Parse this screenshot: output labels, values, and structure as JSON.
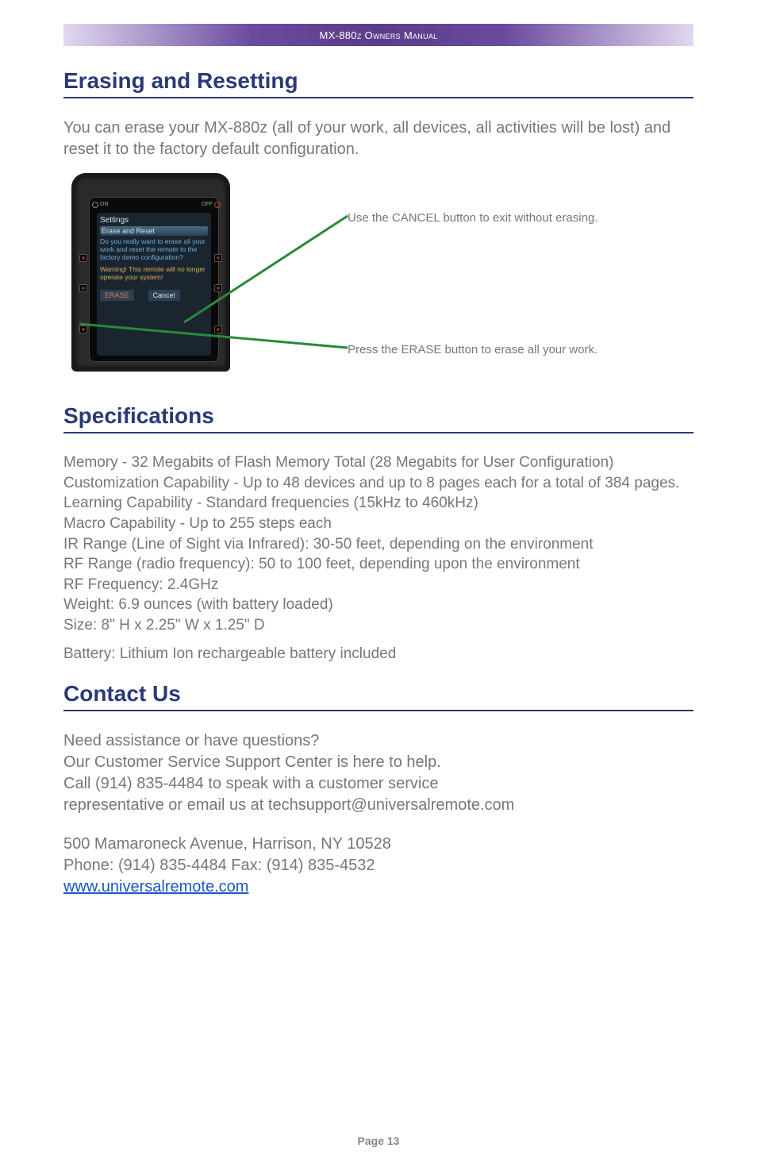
{
  "header": {
    "title": "MX-880z Owners Manual"
  },
  "section1": {
    "heading": "Erasing and Resetting",
    "intro": "You can erase your MX-880z (all of your work, all devices, all activities will be lost) and reset it to the factory default configuration.",
    "callout_cancel": "Use the CANCEL button to exit without erasing.",
    "callout_erase": "Press the ERASE button to erase all your work.",
    "screen": {
      "title": "Settings",
      "subtitle": "Erase and Reset",
      "msg": "Do you really want to erase all your work and reset the remote to the factory demo configuration?",
      "warn": "Warning! This remote will no longer operate your system!",
      "erase": "ERASE",
      "cancel": "Cancel",
      "on": "ON",
      "off": "OFF"
    }
  },
  "section2": {
    "heading": "Specifications",
    "lines": {
      "memory": "Memory - 32 Megabits of Flash Memory Total (28 Megabits for User Configuration)",
      "customization": "Customization Capability - Up to 48 devices and up to 8 pages each for a total of 384 pages.",
      "learning": "Learning Capability - Standard frequencies (15kHz to 460kHz)",
      "macro": "Macro Capability - Up to 255 steps each",
      "ir_range": "IR Range (Line of Sight via Infrared): 30-50 feet, depending on the environment",
      "rf_range": "RF Range (radio frequency): 50 to 100 feet, depending upon the environment",
      "rf_freq": "RF Frequency: 2.4GHz",
      "weight": "Weight: 6.9 ounces (with battery loaded)",
      "size": "Size: 8\" H x 2.25\" W x 1.25\" D",
      "battery": "Battery: Lithium Ion rechargeable battery included"
    }
  },
  "section3": {
    "heading": "Contact Us",
    "q": "Need assistance or have questions?",
    "p1": "Our Customer Service Support Center is here to help.",
    "p2": "Call (914) 835-4484 to speak with a customer service",
    "p3": "representative or email us at techsupport@universalremote.com",
    "addr": "500 Mamaroneck Avenue, Harrison, NY 10528",
    "phone": "Phone: (914) 835-4484  Fax: (914) 835-4532",
    "url": "www.universalremote.com"
  },
  "footer": {
    "page": "Page 13"
  }
}
